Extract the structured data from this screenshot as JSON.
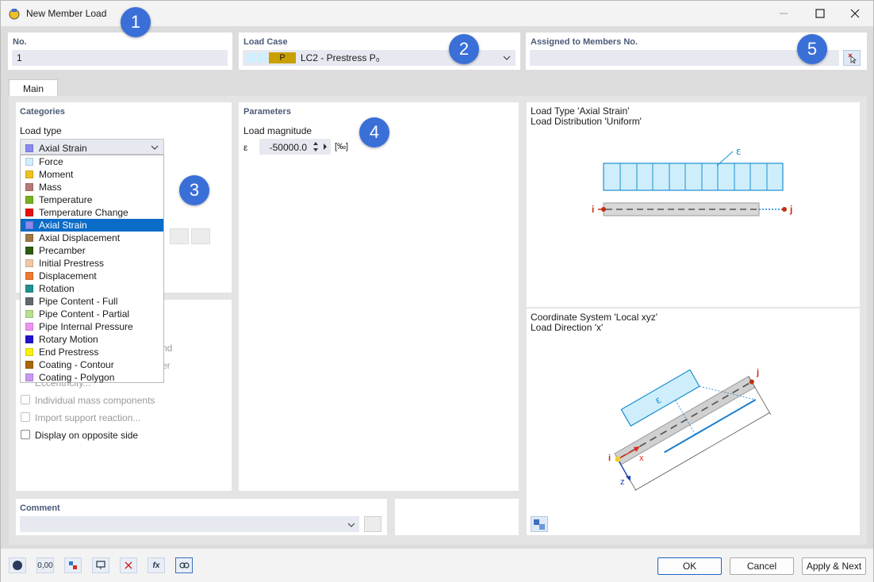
{
  "window": {
    "title": "New Member Load"
  },
  "callouts": [
    "1",
    "2",
    "3",
    "4",
    "5"
  ],
  "no_section": {
    "header": "No.",
    "value": "1"
  },
  "load_case": {
    "header": "Load Case",
    "badge": "P",
    "value": "LC2 - Prestress P₀"
  },
  "assigned": {
    "header": "Assigned to Members No.",
    "value": ""
  },
  "tabs": [
    {
      "label": "Main"
    }
  ],
  "categories": {
    "header": "Categories",
    "load_type_label": "Load type",
    "selected": {
      "label": "Axial Strain",
      "color": "#8a8af0"
    },
    "options": [
      {
        "label": "Force",
        "color": "#cfeeff"
      },
      {
        "label": "Moment",
        "color": "#f0c020"
      },
      {
        "label": "Mass",
        "color": "#b87878"
      },
      {
        "label": "Temperature",
        "color": "#78b020"
      },
      {
        "label": "Temperature Change",
        "color": "#e81010"
      },
      {
        "label": "Axial Strain",
        "color": "#8a8af0"
      },
      {
        "label": "Axial Displacement",
        "color": "#a07840"
      },
      {
        "label": "Precamber",
        "color": "#2e5a10"
      },
      {
        "label": "Initial Prestress",
        "color": "#f0c8a8"
      },
      {
        "label": "Displacement",
        "color": "#f07830"
      },
      {
        "label": "Rotation",
        "color": "#209090"
      },
      {
        "label": "Pipe Content - Full",
        "color": "#606870"
      },
      {
        "label": "Pipe Content - Partial",
        "color": "#b8e090"
      },
      {
        "label": "Pipe Internal Pressure",
        "color": "#f090f0"
      },
      {
        "label": "Rotary Motion",
        "color": "#2010d0"
      },
      {
        "label": "End Prestress",
        "color": "#f8f010"
      },
      {
        "label": "Coating - Contour",
        "color": "#a86808"
      },
      {
        "label": "Coating - Polygon",
        "color": "#c898f0"
      }
    ]
  },
  "options_partial": {
    "row1": "nd",
    "row2": "er",
    "row3": "Eccentricity..."
  },
  "checkboxes": [
    {
      "label": "Individual mass components",
      "enabled": false
    },
    {
      "label": "Import support reaction...",
      "enabled": false
    },
    {
      "label": "Display on opposite side",
      "enabled": true
    }
  ],
  "parameters": {
    "header": "Parameters",
    "magnitude_label": "Load magnitude",
    "symbol": "ε",
    "value": "-50000.0",
    "unit": "[‰]"
  },
  "preview_top": {
    "line1": "Load Type 'Axial Strain'",
    "line2": "Load Distribution 'Uniform'",
    "eps": "ε",
    "node_i": "i",
    "node_j": "j"
  },
  "preview_bottom": {
    "line1": "Coordinate System 'Local xyz'",
    "line2": "Load Direction 'x'",
    "eps": "ε",
    "node_i": "i",
    "node_j": "j",
    "axis_x": "x",
    "axis_z": "z"
  },
  "comment": {
    "header": "Comment",
    "value": ""
  },
  "toolbar": {
    "units_label": "0,00",
    "fx_label": "fx"
  },
  "buttons": {
    "ok": "OK",
    "cancel": "Cancel",
    "apply_next": "Apply & Next"
  }
}
